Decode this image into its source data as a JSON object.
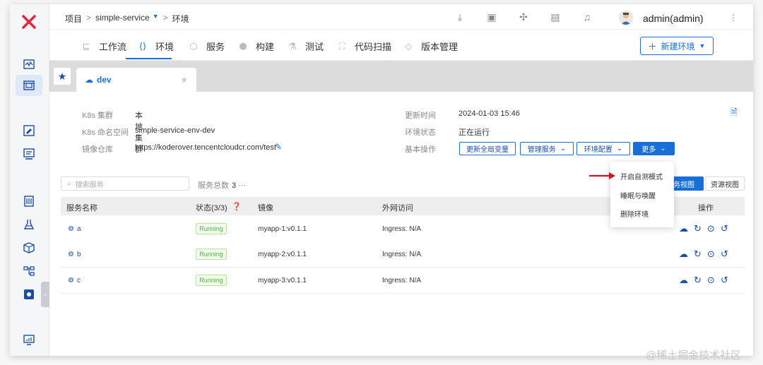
{
  "breadcrumb": {
    "project": "项目",
    "service": "simple-service",
    "page": "环境"
  },
  "user": {
    "name": "admin(admin)"
  },
  "nav": {
    "tabs": [
      {
        "label": "工作流",
        "icon": "workflow-icon"
      },
      {
        "label": "环境",
        "icon": "code-icon"
      },
      {
        "label": "服务",
        "icon": "cube-icon"
      },
      {
        "label": "构建",
        "icon": "box-icon"
      },
      {
        "label": "测试",
        "icon": "flask-icon"
      },
      {
        "label": "代码扫描",
        "icon": "scan-icon"
      },
      {
        "label": "版本管理",
        "icon": "tag-icon"
      }
    ],
    "active_tab": "环境",
    "new_env_label": "新建环境"
  },
  "env_tab": {
    "label": "dev"
  },
  "info": {
    "cluster_label": "K8s 集群",
    "cluster_value": "本地集群",
    "ns_label": "K8s 命名空间",
    "ns_value": "simple-service-env-dev",
    "registry_label": "镜像仓库",
    "registry_value": "https://koderover.tencentcloudcr.com/test",
    "updated_label": "更新时间",
    "updated_value": "2024-01-03 15:46",
    "status_label": "环境状态",
    "status_value": "正在运行",
    "ops_label": "基本操作"
  },
  "ops": {
    "update_vars": "更新全局变量",
    "manage_services": "管理服务",
    "env_config": "环境配置",
    "more": "更多"
  },
  "search": {
    "placeholder": "搜索服务"
  },
  "services_total": {
    "label": "服务总数",
    "count": "3"
  },
  "views": {
    "service_view": "服务视图",
    "resource_view": "资源视图",
    "service_view_visible": "务视图"
  },
  "table": {
    "headers": {
      "name": "服务名称",
      "status": "状态(3/3)",
      "image": "镜像",
      "ingress": "外网访问",
      "actions": "操作"
    },
    "rows": [
      {
        "name": "a",
        "status": "Running",
        "image": "myapp-1:v0.1.1",
        "ingress": "Ingress: N/A"
      },
      {
        "name": "b",
        "status": "Running",
        "image": "myapp-2:v0.1.1",
        "ingress": "Ingress: N/A"
      },
      {
        "name": "c",
        "status": "Running",
        "image": "myapp-3:v0.1.1",
        "ingress": "Ingress: N/A"
      }
    ]
  },
  "more_menu": {
    "items": [
      "开启自测模式",
      "睡眠与唤醒",
      "删除环境"
    ]
  },
  "watermark": "@稀土掘金技术社区",
  "colors": {
    "accent": "#1a6ed8",
    "brand_red": "#e3263b",
    "running_green": "#52b04c"
  }
}
